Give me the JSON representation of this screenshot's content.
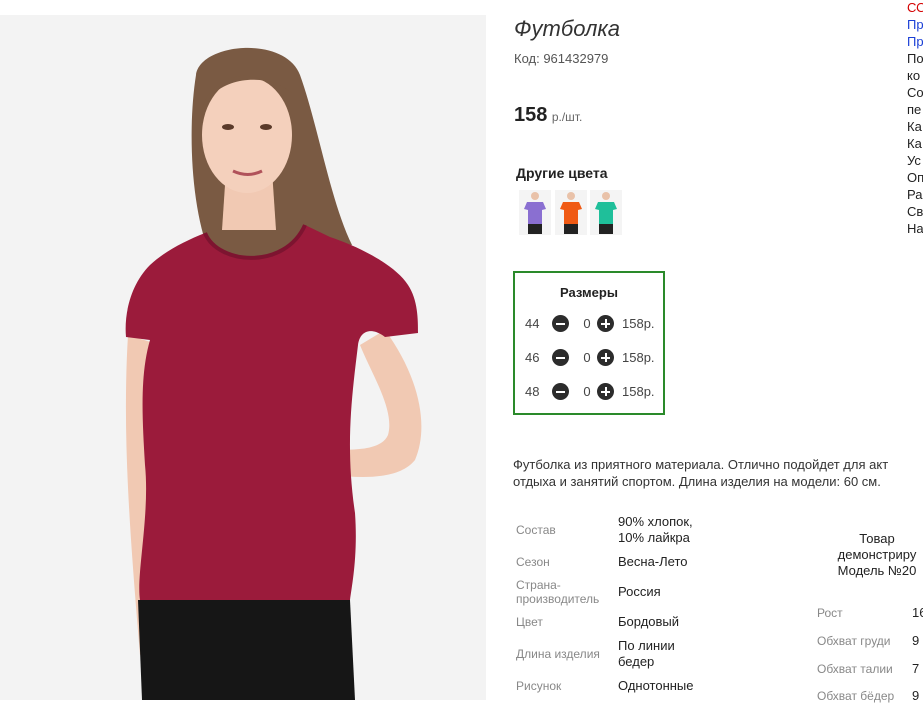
{
  "product": {
    "title": "Футболка",
    "code": "Код: 961432979",
    "price_value": "158",
    "price_unit": "р./шт."
  },
  "other_colors": {
    "title": "Другие цвета",
    "swatches": [
      {
        "color": "#8a6fd1"
      },
      {
        "color": "#f05a14"
      },
      {
        "color": "#1fbf9a"
      }
    ]
  },
  "sizes": {
    "title": "Размеры",
    "rows": [
      {
        "size": "44",
        "qty": "0",
        "price": "158р."
      },
      {
        "size": "46",
        "qty": "0",
        "price": "158р."
      },
      {
        "size": "48",
        "qty": "0",
        "price": "158р."
      }
    ]
  },
  "description": {
    "line1": "Футболка из приятного материала. Отлично подойдет для акт",
    "line2": "отдыха и занятий спортом. Длина изделия на модели: 60 см."
  },
  "specs": {
    "composition_label": "Состав",
    "composition_value_1": "90% хлопок,",
    "composition_value_2": "10% лайкра",
    "season_label": "Сезон",
    "season_value": "Весна-Лето",
    "country_label_1": "Страна-",
    "country_label_2": "производитель",
    "country_value": "Россия",
    "color_label": "Цвет",
    "color_value": "Бордовый",
    "length_label": "Длина изделия",
    "length_value_1": "По линии",
    "length_value_2": "бедер",
    "pattern_label": "Рисунок",
    "pattern_value": "Однотонные"
  },
  "model": {
    "note_1": "Товар",
    "note_2": "демонстриру",
    "note_3": "Модель №20",
    "height_label": "Рост",
    "height_value": "16",
    "chest_label": "Обхват груди",
    "chest_value": "9",
    "waist_label": "Обхват талии",
    "waist_value": "7",
    "hips_label": "Обхват бёдер",
    "hips_value": "9"
  },
  "sidebar": {
    "items": [
      {
        "text": "СО",
        "color": "#d40000"
      },
      {
        "text": "Пр",
        "color": "#1a3fd6"
      },
      {
        "text": "Пр",
        "color": "#1a3fd6"
      },
      {
        "text": "По",
        "color": "#222222"
      },
      {
        "text": "ко",
        "color": "#222222"
      },
      {
        "text": "Со",
        "color": "#222222"
      },
      {
        "text": "пе",
        "color": "#222222"
      },
      {
        "text": "Ка",
        "color": "#222222"
      },
      {
        "text": "Ка",
        "color": "#222222"
      },
      {
        "text": "Ус",
        "color": "#222222"
      },
      {
        "text": "Оп",
        "color": "#222222"
      },
      {
        "text": "Ра",
        "color": "#222222"
      },
      {
        "text": "Св",
        "color": "#222222"
      },
      {
        "text": "На",
        "color": "#222222"
      }
    ]
  },
  "colors": {
    "shirt": "#9b1b3b",
    "sizes_border": "#2a8a2a"
  }
}
